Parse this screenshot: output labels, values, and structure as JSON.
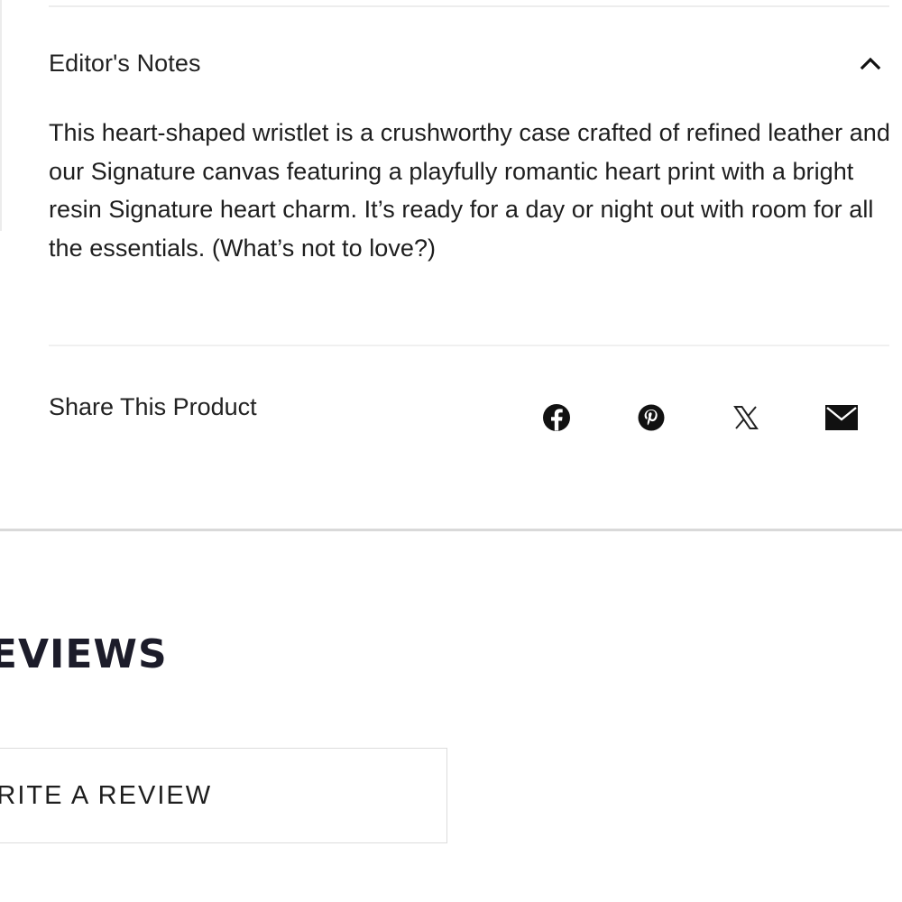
{
  "editors_notes": {
    "title": "Editor's Notes",
    "toggle_icon": "chevron-up-icon",
    "expanded": true,
    "body": "This heart-shaped wristlet is a crushworthy case crafted of refined leather and our Signature canvas featuring a playfully romantic heart print with a bright resin Signature heart charm. It’s ready for a day or night out with room for all the essentials. (What’s not to love?)"
  },
  "share": {
    "label": "Share This Product",
    "icons": [
      "facebook-icon",
      "pinterest-icon",
      "x-icon",
      "email-icon"
    ]
  },
  "reviews": {
    "heading": "REVIEWS",
    "write_review_label": "WRITE A REVIEW"
  },
  "colors": {
    "text": "#1a1a1a",
    "divider": "#d9d9d9",
    "heading": "#1c1c2a"
  }
}
